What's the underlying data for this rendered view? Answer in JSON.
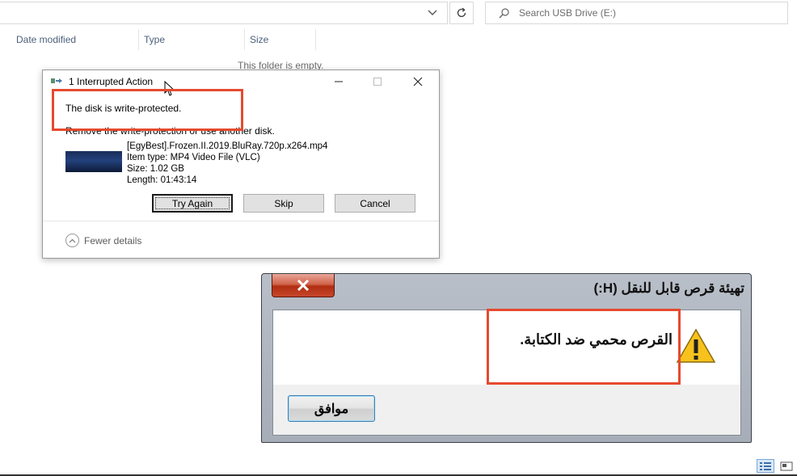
{
  "explorer": {
    "search_placeholder": "Search USB Drive (E:)",
    "columns": [
      "Date modified",
      "Type",
      "Size"
    ],
    "empty_message": "This folder is empty."
  },
  "dialog1": {
    "title": "1 Interrupted Action",
    "heading": "The disk is write-protected.",
    "subtext": "Remove the write-protection or use another disk.",
    "file": {
      "name": "[EgyBest].Frozen.II.2019.BluRay.720p.x264.mp4",
      "type": "Item type: MP4 Video File (VLC)",
      "size": "Size: 1.02 GB",
      "length": "Length: 01:43:14"
    },
    "buttons": {
      "try_again": "Try Again",
      "skip": "Skip",
      "cancel": "Cancel"
    },
    "fewer_details": "Fewer details"
  },
  "dialog2": {
    "title": "تهيئة قرص قابل للنقل (H:)",
    "message": "القرص محمي ضد الكتابة.",
    "ok": "موافق"
  },
  "colors": {
    "highlight": "#e64a2f"
  },
  "icons": [
    "chevron-down-icon",
    "refresh-icon",
    "search-icon",
    "copy-action-icon",
    "minimize-icon",
    "maximize-icon",
    "close-icon",
    "chevron-up-icon",
    "warning-icon",
    "details-view-icon",
    "tiles-view-icon",
    "mouse-cursor-icon"
  ]
}
